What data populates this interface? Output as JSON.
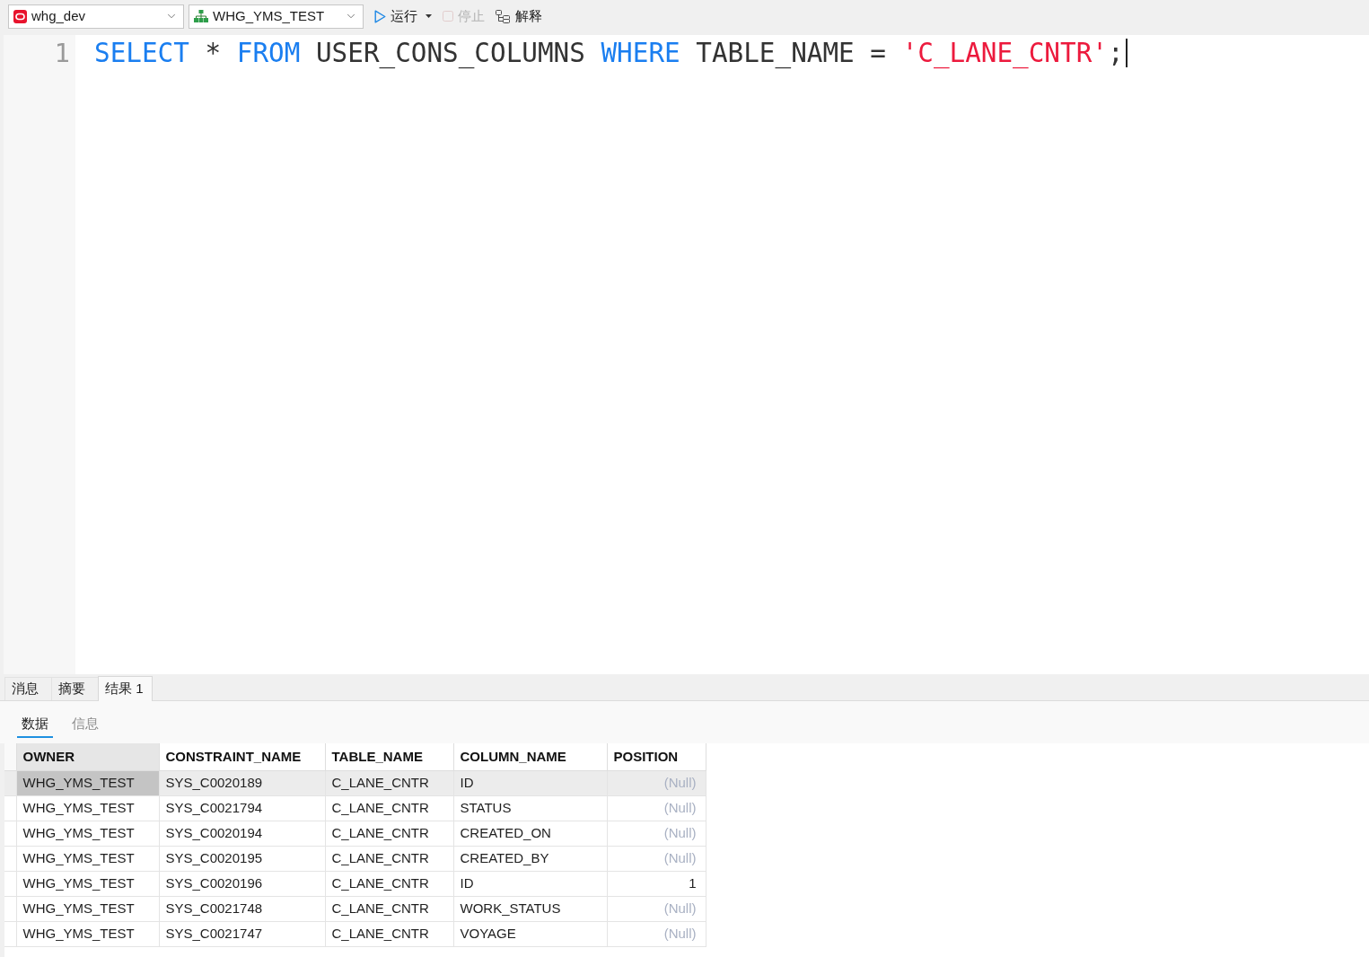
{
  "toolbar": {
    "connection": {
      "value": "whg_dev"
    },
    "schema": {
      "value": "WHG_YMS_TEST"
    },
    "buttons": [
      {
        "kind": "run",
        "label": "运行",
        "disabled": false
      },
      {
        "kind": "stop",
        "label": "停止",
        "disabled": true
      },
      {
        "kind": "explain",
        "label": "解释",
        "disabled": false
      }
    ]
  },
  "editor": {
    "lines": [
      {
        "number": "1",
        "tokens": [
          {
            "text": "SELECT",
            "kind": "keyword"
          },
          {
            "text": "*",
            "kind": "operator"
          },
          {
            "text": "FROM",
            "kind": "keyword"
          },
          {
            "text": "USER_CONS_COLUMNS",
            "kind": "identifier"
          },
          {
            "text": "WHERE",
            "kind": "keyword"
          },
          {
            "text": "TABLE_NAME",
            "kind": "identifier"
          },
          {
            "text": "=",
            "kind": "operator"
          },
          {
            "text": "'C_LANE_CNTR'",
            "kind": "string"
          },
          {
            "text": ";",
            "kind": "punctuation"
          }
        ]
      }
    ]
  },
  "result_panel": {
    "tabs": [
      {
        "label": "消息",
        "selected": false
      },
      {
        "label": "摘要",
        "selected": false
      },
      {
        "label": "结果 1",
        "selected": true
      }
    ],
    "subtabs": [
      {
        "label": "数据",
        "selected": true
      },
      {
        "label": "信息",
        "selected": false
      }
    ],
    "table": {
      "columns": [
        {
          "label": "OWNER",
          "selected": true
        },
        {
          "label": "CONSTRAINT_NAME",
          "selected": false
        },
        {
          "label": "TABLE_NAME",
          "selected": false
        },
        {
          "label": "COLUMN_NAME",
          "selected": false
        },
        {
          "label": "POSITION",
          "selected": false
        }
      ],
      "rows": [
        {
          "selected": true,
          "cells": [
            "WHG_YMS_TEST",
            "SYS_C0020189",
            "C_LANE_CNTR",
            "ID"
          ],
          "position": {
            "text": "(Null)",
            "kind": "null"
          }
        },
        {
          "selected": false,
          "cells": [
            "WHG_YMS_TEST",
            "SYS_C0021794",
            "C_LANE_CNTR",
            "STATUS"
          ],
          "position": {
            "text": "(Null)",
            "kind": "null"
          }
        },
        {
          "selected": false,
          "cells": [
            "WHG_YMS_TEST",
            "SYS_C0020194",
            "C_LANE_CNTR",
            "CREATED_ON"
          ],
          "position": {
            "text": "(Null)",
            "kind": "null"
          }
        },
        {
          "selected": false,
          "cells": [
            "WHG_YMS_TEST",
            "SYS_C0020195",
            "C_LANE_CNTR",
            "CREATED_BY"
          ],
          "position": {
            "text": "(Null)",
            "kind": "null"
          }
        },
        {
          "selected": false,
          "cells": [
            "WHG_YMS_TEST",
            "SYS_C0020196",
            "C_LANE_CNTR",
            "ID"
          ],
          "position": {
            "text": "1",
            "kind": "number"
          }
        },
        {
          "selected": false,
          "cells": [
            "WHG_YMS_TEST",
            "SYS_C0021748",
            "C_LANE_CNTR",
            "WORK_STATUS"
          ],
          "position": {
            "text": "(Null)",
            "kind": "null"
          }
        },
        {
          "selected": false,
          "cells": [
            "WHG_YMS_TEST",
            "SYS_C0021747",
            "C_LANE_CNTR",
            "VOYAGE"
          ],
          "position": {
            "text": "(Null)",
            "kind": "null"
          }
        }
      ]
    }
  }
}
